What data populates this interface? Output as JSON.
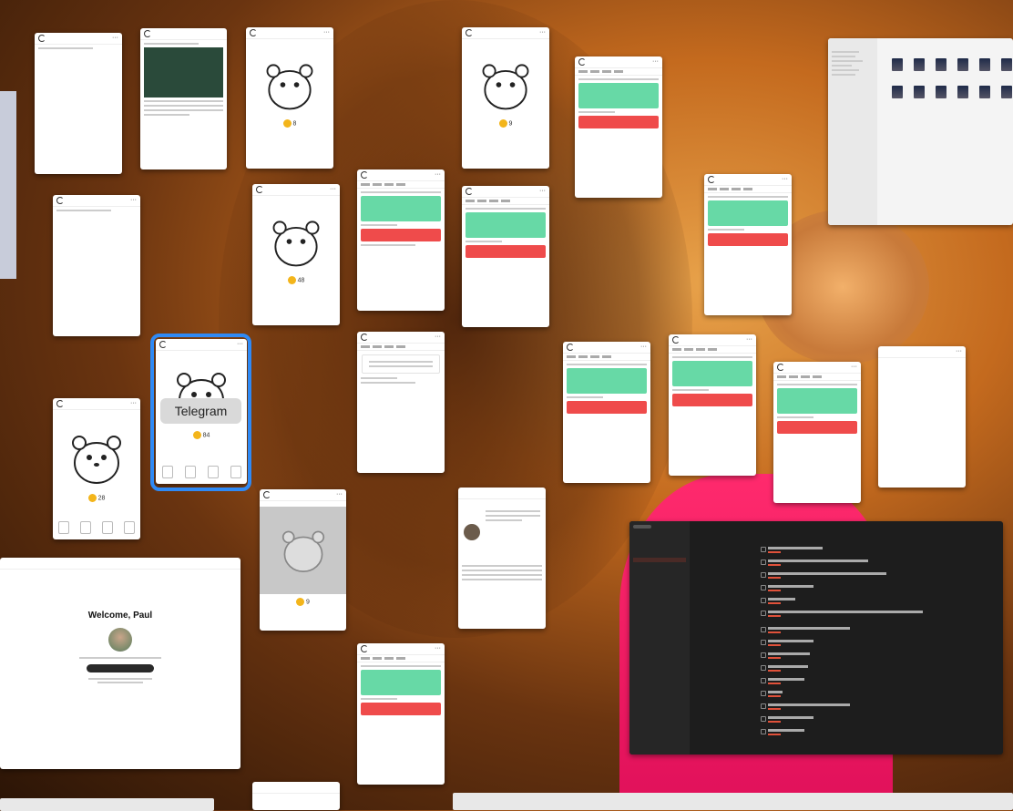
{
  "desktop": {
    "background": "horse-and-girl-photo"
  },
  "labels": {
    "telegram": "Telegram",
    "welcome": "Welcome, Paul"
  },
  "coins": {
    "w_top_center": "8",
    "w_top_right": "9",
    "w_mid": "48",
    "w_selected": "84",
    "w_left_bottom": "28",
    "w_gray": "9"
  },
  "colors": {
    "focus_ring": "#2f8af5",
    "coin": "#f3b51b",
    "ticket_green": "#67d9a6",
    "ticket_red": "#ef4b4b",
    "notes_accent": "#e0513a"
  }
}
